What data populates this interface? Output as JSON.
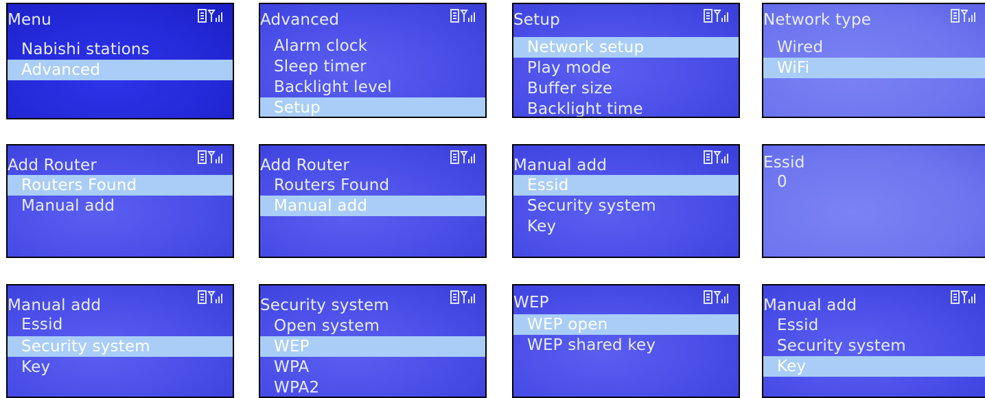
{
  "screens": [
    {
      "title": "Menu",
      "items": [
        "Nabishi stations",
        "Advanced"
      ],
      "selected": 1
    },
    {
      "title": "Advanced",
      "items": [
        "Alarm clock",
        "Sleep timer",
        "Backlight level",
        "Setup"
      ],
      "selected": 3
    },
    {
      "title": "Setup",
      "items": [
        "Network setup",
        "Play mode",
        "Buffer size",
        "Backlight time"
      ],
      "selected": 0
    },
    {
      "title": "Network type",
      "items": [
        "Wired",
        "WiFi"
      ],
      "selected": 1
    },
    {
      "title": "Add Router",
      "items": [
        "Routers Found",
        "Manual add"
      ],
      "selected": 0
    },
    {
      "title": "Add Router",
      "items": [
        "Routers Found",
        "Manual add"
      ],
      "selected": 1
    },
    {
      "title": "Manual add",
      "items": [
        "Essid",
        "Security system",
        "Key"
      ],
      "selected": 0
    },
    {
      "title": "Essid",
      "items": [
        "0"
      ],
      "selected": -1
    },
    {
      "title": "Manual add",
      "items": [
        "Essid",
        "Security system",
        "Key"
      ],
      "selected": 1
    },
    {
      "title": "Security system",
      "items": [
        "Open system",
        "WEP",
        "WPA",
        "WPA2"
      ],
      "selected": 1
    },
    {
      "title": "WEP",
      "items": [
        "WEP open",
        "WEP shared key"
      ],
      "selected": 0
    },
    {
      "title": "Manual add",
      "items": [
        "Essid",
        "Security system",
        "Key"
      ],
      "selected": 2
    }
  ],
  "status_icons": [
    "battery-icon",
    "signal-icon"
  ],
  "colors": {
    "screen": "#4a4ee8",
    "highlight": "#a9cdf6",
    "text": "#e8ecff"
  }
}
